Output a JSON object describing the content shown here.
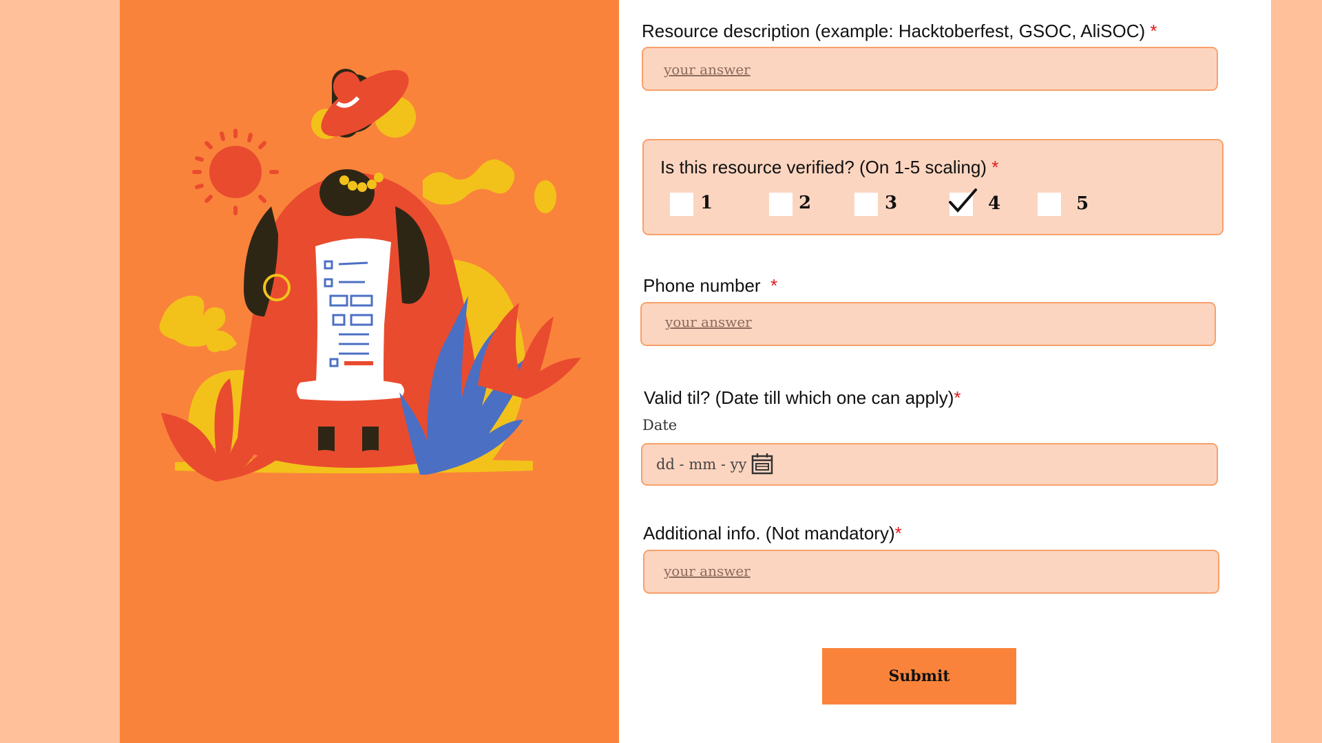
{
  "form": {
    "resource_description": {
      "label": "Resource description (example: Hacktoberfest, GSOC, AliSOC)",
      "required_mark": "*",
      "placeholder": "your answer"
    },
    "verified": {
      "label": "Is this resource verified? (On 1-5 scaling)",
      "required_mark": "*",
      "options": [
        "1",
        "2",
        "3",
        "4",
        "5"
      ],
      "selected": "4"
    },
    "phone": {
      "label": "Phone number",
      "required_mark": "*",
      "placeholder": "your answer"
    },
    "valid_til": {
      "label": "Valid til? (Date till which one can apply)",
      "required_mark": "*",
      "sublabel": "Date",
      "placeholder": "dd - mm - yy",
      "icon": "calendar-icon"
    },
    "additional_info": {
      "label": "Additional info. (Not mandatory)",
      "required_mark": "*",
      "placeholder": "your answer"
    },
    "submit_label": "Submit"
  },
  "colors": {
    "page_bg": "#ffc09a",
    "panel_orange": "#fa833b",
    "field_bg": "#fcd5c0",
    "field_border": "#f7a06a",
    "required": "#e0191c"
  }
}
